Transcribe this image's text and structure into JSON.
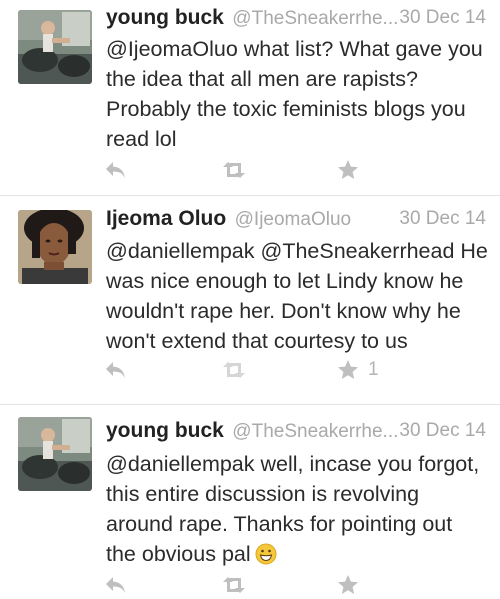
{
  "tweets": [
    {
      "name": "young buck",
      "handle": "@TheSneakerrhe...",
      "date": "30 Dec 14",
      "text": "@IjeomaOluo what list? What gave you the idea that all men are rapists? Probably the toxic feminists blogs you read lol",
      "favorite_count": ""
    },
    {
      "name": "Ijeoma Oluo",
      "handle": "@IjeomaOluo",
      "date": "30 Dec 14",
      "text": "@daniellempak @TheSneakerrhead He was nice enough to let Lindy know he wouldn't rape her. Don't know why he won't extend that courtesy to us",
      "favorite_count": "1"
    },
    {
      "name": "young buck",
      "handle": "@TheSneakerrhe...",
      "date": "30 Dec 14",
      "text": "@daniellempak well, incase you forgot, this entire discussion is revolving around rape. Thanks for pointing out the obvious pal",
      "favorite_count": ""
    }
  ],
  "icons": {
    "reply": "reply-icon",
    "retweet": "retweet-icon",
    "favorite": "star-icon",
    "emoji": "grinning-face-emoji"
  },
  "colors": {
    "action_icon": "#bfbfbf",
    "meta_text": "#a9a9a9",
    "emoji": "#f5c73a"
  }
}
